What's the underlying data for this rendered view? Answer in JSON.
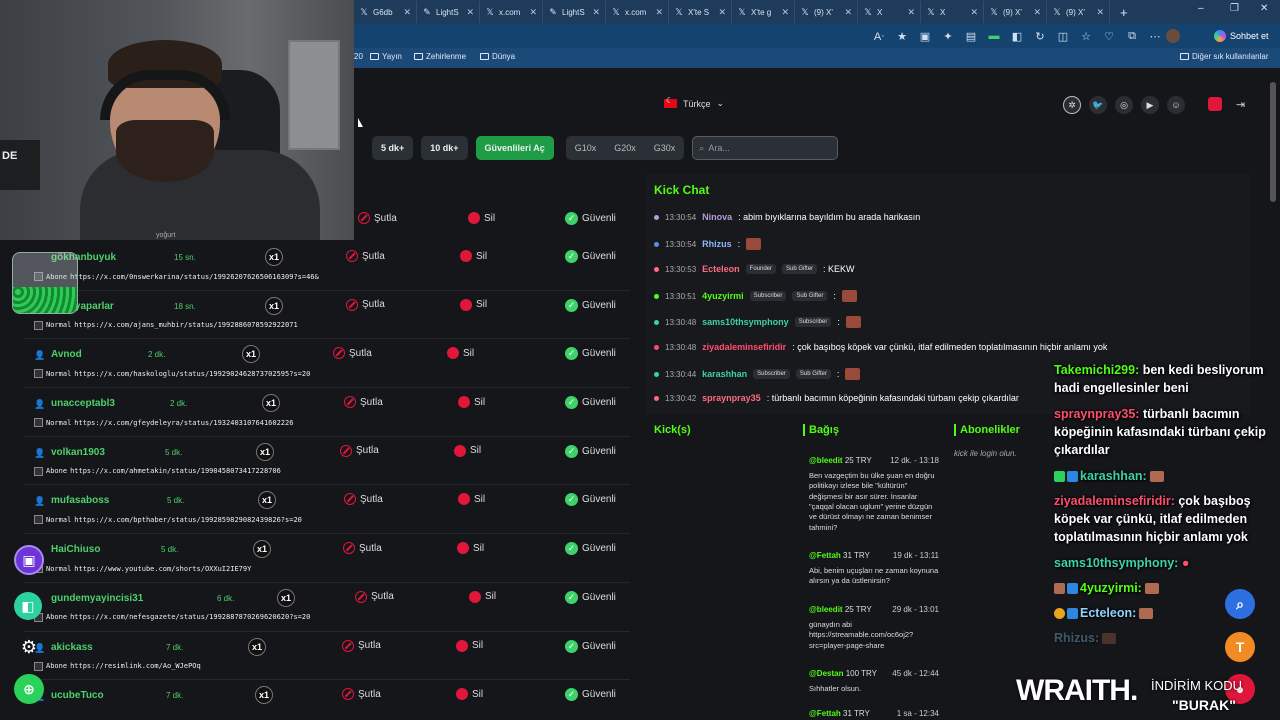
{
  "browser": {
    "tabs": [
      {
        "label": "G6db",
        "icon": "x-icon"
      },
      {
        "label": "LightS",
        "icon": "pen-icon"
      },
      {
        "label": "x.com",
        "icon": "x-icon"
      },
      {
        "label": "LightS",
        "icon": "pen-icon"
      },
      {
        "label": "x.com",
        "icon": "x-icon"
      },
      {
        "label": "X'te S",
        "icon": "x-icon"
      },
      {
        "label": "X'te g",
        "icon": "x-icon"
      },
      {
        "label": "(9) X'",
        "icon": "x-icon"
      },
      {
        "label": "X",
        "icon": "x-icon"
      },
      {
        "label": "X",
        "icon": "x-icon"
      },
      {
        "label": "(9) X'",
        "icon": "x-icon"
      },
      {
        "label": "(9) X'",
        "icon": "x-icon"
      }
    ],
    "sohbet_label": "Sohbet et",
    "bookmarks": [
      "Yayın",
      "Zehirlenme",
      "Dünya"
    ],
    "bookmark_prefix": "20",
    "other_bookmarks": "Diğer sık kullanılanlar"
  },
  "header": {
    "language": "Türkçe"
  },
  "controls": {
    "btn_5": "5 dk+",
    "btn_10": "10 dk+",
    "btn_safe": "Güvenlileri Aç",
    "filters": [
      "G10x",
      "G20x",
      "G30x"
    ],
    "search_placeholder": "Ara..."
  },
  "list": {
    "sutla_label": "Şutla",
    "sil_label": "Sil",
    "guvenli_label": "Güvenli",
    "partial_user": "yoğurt",
    "rows": [
      {
        "user": "gökhanbuyuk",
        "time": "15 sn.",
        "mult": "x1",
        "type": "Abone",
        "url": "https://x.com/0nswerkarina/status/1992620762650616309?s=46&",
        "purple": false
      },
      {
        "user": "alperyaparlar",
        "time": "18 sn.",
        "mult": "x1",
        "type": "Normal",
        "url": "https://x.com/ajans_muhbir/status/1992886078592922071",
        "purple": false
      },
      {
        "user": "Avnod",
        "time": "2 dk.",
        "mult": "x1",
        "type": "Normal",
        "url": "https://x.com/haskologlu/status/1992902462873702595?s=20",
        "purple": true
      },
      {
        "user": "unacceptabl3",
        "time": "2 dk.",
        "mult": "x1",
        "type": "Normal",
        "url": "https://x.com/gfeydeleyra/status/1932403107641602226",
        "purple": true
      },
      {
        "user": "volkan1903",
        "time": "5 dk.",
        "mult": "x1",
        "type": "Abone",
        "url": "https://x.com/ahmetakin/status/1990458073417228706",
        "purple": true
      },
      {
        "user": "mufasaboss",
        "time": "5 dk.",
        "mult": "x1",
        "type": "Normal",
        "url": "https://x.com/bpthaber/status/1992859829082439826?s=20",
        "purple": true
      },
      {
        "user": "HaiChiuso",
        "time": "5 dk.",
        "mult": "x1",
        "type": "Normal",
        "url": "https://www.youtube.com/shorts/OXXuI2IE79Y",
        "purple": false
      },
      {
        "user": "gundemyayincisi31",
        "time": "6 dk.",
        "mult": "x1",
        "type": "Abone",
        "url": "https://x.com/nefesgazete/status/1992887870269620620?s=20",
        "purple": false
      },
      {
        "user": "akickass",
        "time": "7 dk.",
        "mult": "x1",
        "type": "Abone",
        "url": "https://resimlink.com/Ao_WJePOq",
        "purple": true
      },
      {
        "user": "ucubeTuco",
        "time": "7 dk.",
        "mult": "x1",
        "type": "",
        "url": "",
        "purple": true
      }
    ]
  },
  "chat": {
    "title": "Kick Chat",
    "messages": [
      {
        "time": "13:30:54",
        "user": "Ninova",
        "color": "#b39ddb",
        "dot": "#b39ddb",
        "badges": [],
        "text": ": abim bıyıklarına bayıldım bu arada harikasın",
        "emote": false
      },
      {
        "time": "13:30:54",
        "user": "Rhizus",
        "color": "#8fb6ff",
        "dot": "#5b8def",
        "badges": [],
        "text": ":",
        "emote": true
      },
      {
        "time": "13:30:53",
        "user": "Ecteleon",
        "color": "#ff6b81",
        "dot": "#ff6b81",
        "badges": [
          "Founder",
          "Sub Gifter"
        ],
        "text": ": KEKW",
        "emote": false
      },
      {
        "time": "13:30:51",
        "user": "4yuzyirmi",
        "color": "#53fc18",
        "dot": "#53fc18",
        "badges": [
          "Subscriber",
          "Sub Gifter"
        ],
        "text": ":",
        "emote": true
      },
      {
        "time": "13:30:48",
        "user": "sams10thsymphony",
        "color": "#3fd2a0",
        "dot": "#3fd2a0",
        "badges": [
          "Subscriber"
        ],
        "text": ":",
        "emote": true
      },
      {
        "time": "13:30:48",
        "user": "ziyadaleminsefiridir",
        "color": "#ff4d6d",
        "dot": "#ff4d6d",
        "badges": [],
        "text": ": çok başıboş köpek var çünkü, itlaf edilmeden toplatılmasının hiçbir anlamı yok",
        "emote": false
      },
      {
        "time": "13:30:44",
        "user": "karashhan",
        "color": "#3fd2a0",
        "dot": "#3fd2a0",
        "badges": [
          "Subscriber",
          "Sub Gifter"
        ],
        "text": ":",
        "emote": true
      },
      {
        "time": "13:30:42",
        "user": "spraynpray35",
        "color": "#ff6b81",
        "dot": "#ff6b81",
        "badges": [],
        "text": ": türbanlı bacımın köpeğinin kafasındaki türbanı çekip çıkardılar",
        "emote": false
      }
    ]
  },
  "sections": {
    "kicks": "Kick(s)",
    "bagis": "Bağış",
    "aboneler": "Abonelikler",
    "aboneler_note": "kick ile login olun."
  },
  "donations": [
    {
      "user": "@bleedit",
      "amount": "25 TRY",
      "time": "12 dk. - 13:18",
      "text": "Ben vazgeçtim bu ülke şuan en doğru politikayı izlese bile \"kültürün\" değişmesi bir asır sürer. İnsanlar \"çaqqal olacan uglum\" yerine düzgün ve dürüst olmayı ne zaman benimser tahmini?"
    },
    {
      "user": "@Fettah",
      "amount": "31 TRY",
      "time": "19 dk - 13:11",
      "text": "Abi, benim uçuşları ne zaman koynuna alırsın ya da üstlenirsin?"
    },
    {
      "user": "@bleedit",
      "amount": "25 TRY",
      "time": "29 dk - 13:01",
      "text": "günaydın abi https://streamable.com/oc6oj2?src=player-page-share"
    },
    {
      "user": "@Destan",
      "amount": "100 TRY",
      "time": "45 dk - 12:44",
      "text": "Sıhhatler olsun."
    },
    {
      "user": "@Fettah",
      "amount": "31 TRY",
      "time": "1 sa - 12:34",
      "text": ""
    }
  ],
  "overlay": {
    "line1_user": "Takemichi299:",
    "line1_text": "ben kedi besliyorum hadi engellesinler beni",
    "line2_user": "spraynpray35:",
    "line2_text": "türbanlı bacımın köpeğinin kafasındaki türbanı çekip çıkardılar",
    "line3_user": "karashhan:",
    "line4_user": "ziyadaleminsefiridir:",
    "line4_text": "çok başıboş köpek var çünkü, itlaf edilmeden toplatılmasının hiçbir anlamı yok",
    "line5_user": "sams10thsymphony:",
    "line6_user": "4yuzyirmi:",
    "line7_user": "Ecteleon:",
    "line8_user": "Rhizus:"
  },
  "webcam": {
    "mic_label": "DE"
  },
  "sponsor": {
    "brand": "WRAITH.",
    "discount": "İNDİRİM KODU",
    "code": "\"BURAK\""
  },
  "fab": {
    "t_label": "T"
  }
}
